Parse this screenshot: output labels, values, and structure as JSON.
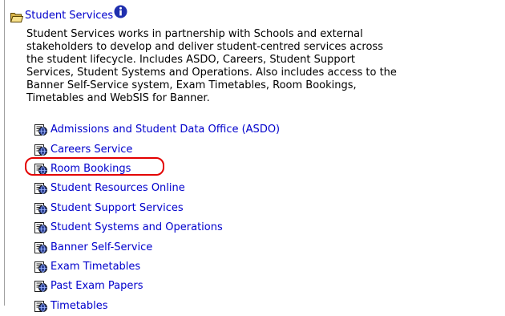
{
  "section": {
    "title": "Student Services",
    "folder_icon": "open-folder-icon",
    "info_icon": "info-icon",
    "description": "Student Services works in partnership with Schools and external\nstakeholders to develop and deliver student-centred services across\nthe student lifecycle. Includes ASDO, Careers, Student Support\nServices, Student Systems and Operations. Also includes access to the\nBanner Self-Service system, Exam Timetables, Room Bookings,\nTimetables and WebSIS for Banner.",
    "links": [
      {
        "label": "Admissions and Student Data Office (ASDO)",
        "icon": "web-page-icon"
      },
      {
        "label": "Careers Service",
        "icon": "web-page-icon"
      },
      {
        "label": "Room Bookings",
        "icon": "web-page-icon",
        "highlighted": true
      },
      {
        "label": "Student Resources Online",
        "icon": "web-page-icon"
      },
      {
        "label": "Student Support Services",
        "icon": "web-page-icon"
      },
      {
        "label": "Student Systems and Operations",
        "icon": "web-page-icon"
      },
      {
        "label": "Banner Self-Service",
        "icon": "web-page-icon"
      },
      {
        "label": "Exam Timetables",
        "icon": "web-page-icon"
      },
      {
        "label": "Past Exam Papers",
        "icon": "web-page-icon"
      },
      {
        "label": "Timetables",
        "icon": "web-page-icon"
      }
    ]
  },
  "colors": {
    "link": "#0000cc",
    "highlight": "#e30000",
    "info_icon": "#1f2fae"
  }
}
